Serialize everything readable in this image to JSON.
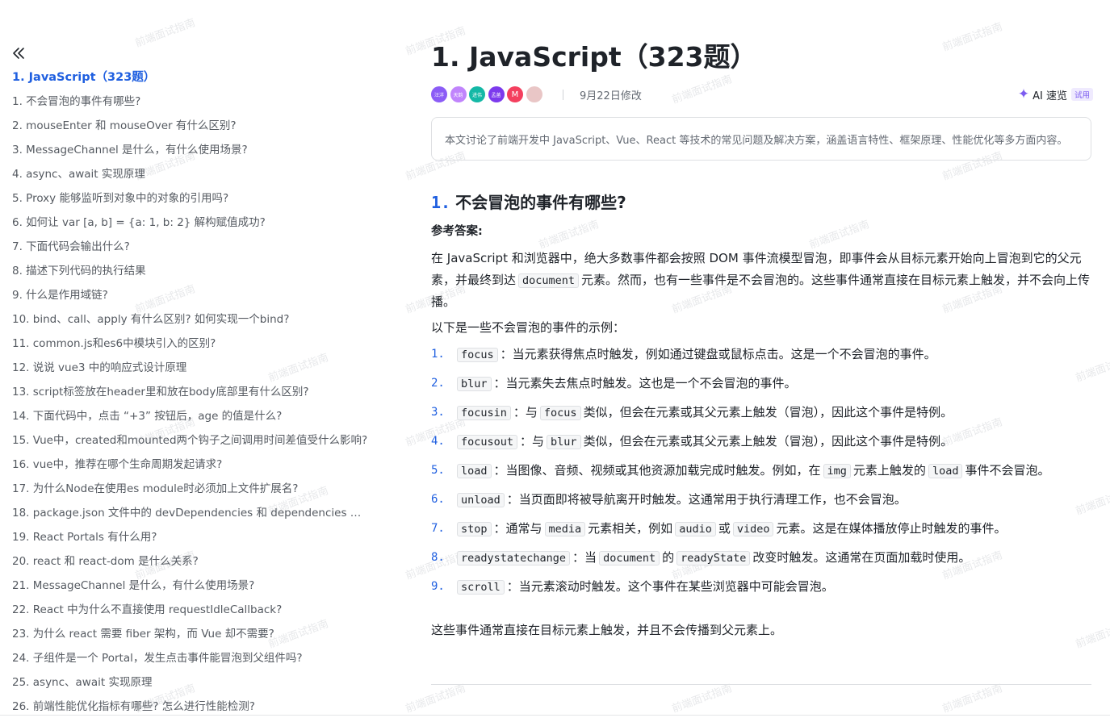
{
  "watermark": "前端面试指南",
  "sidebar": {
    "items": [
      "1. JavaScript（323题）",
      "1. 不会冒泡的事件有哪些?",
      "2. mouseEnter 和 mouseOver 有什么区别?",
      "3. MessageChannel 是什么，有什么使用场景?",
      "4. async、await 实现原理",
      "5. Proxy 能够监听到对象中的对象的引用吗?",
      "6. 如何让 var [a, b] = {a: 1, b: 2} 解构赋值成功?",
      "7. 下面代码会输出什么?",
      "8. 描述下列代码的执行结果",
      "9. 什么是作用域链?",
      "10. bind、call、apply 有什么区别? 如何实现一个bind?",
      "11. common.js和es6中模块引入的区别?",
      "12. 说说 vue3 中的响应式设计原理",
      "13. script标签放在header里和放在body底部里有什么区别?",
      "14. 下面代码中，点击 “+3” 按钮后，age 的值是什么?",
      "15. Vue中，created和mounted两个钩子之间调用时间差值受什么影响?",
      "16. vue中，推荐在哪个生命周期发起请求?",
      "17. 为什么Node在使用es module时必须加上文件扩展名?",
      "18. package.json 文件中的 devDependencies 和 dependencies 对象有...",
      "19. React Portals 有什么用?",
      "20. react 和 react-dom 是什么关系?",
      "21. MessageChannel 是什么，有什么使用场景?",
      "22. React 中为什么不直接使用 requestIdleCallback?",
      "23. 为什么 react 需要 fiber 架构，而 Vue 却不需要?",
      "24. 子组件是一个 Portal，发生点击事件能冒泡到父组件吗?",
      "25. async、await 实现原理",
      "26. 前端性能优化指标有哪些? 怎么进行性能检测?"
    ]
  },
  "doc": {
    "title": "1. JavaScript（323题）",
    "avatars": [
      {
        "label": "汪洋",
        "color": "#8b5cf6"
      },
      {
        "label": "天韵",
        "color": "#c084fc"
      },
      {
        "label": "进伟",
        "color": "#14b8a6"
      },
      {
        "label": "孟菡",
        "color": "#7c3aed"
      },
      {
        "label": "M",
        "color": "#f43f5e"
      },
      {
        "label": "",
        "color": "#e9c6c6"
      }
    ],
    "modified": "9月22日修改",
    "ai_label": "AI 速览",
    "ai_badge": "试用",
    "summary": "本文讨论了前端开发中 JavaScript、Vue、React 等技术的常见问题及解决方案，涵盖语言特性、框架原理、性能优化等多方面内容。"
  },
  "question": {
    "number": "1.",
    "title": "不会冒泡的事件有哪些?",
    "answer_label": "参考答案:",
    "para1": {
      "t1": "在 JavaScript 和浏览器中，绝大多数事件都会按照 DOM 事件流模型冒泡，即事件会从目标元素开始向上冒泡到它的父元素，并最终到达",
      "c1": "document",
      "t2": "元素。然而，也有一些事件是不会冒泡的。这些事件通常直接在目标元素上触发，并不会向上传播。"
    },
    "intro": "以下是一些不会冒泡的事件的示例：",
    "items": [
      {
        "n": "1.",
        "c1": "focus",
        "t1": "：当元素获得焦点时触发，例如通过键盘或鼠标点击。这是一个不会冒泡的事件。"
      },
      {
        "n": "2.",
        "c1": "blur",
        "t1": "：当元素失去焦点时触发。这也是一个不会冒泡的事件。"
      },
      {
        "n": "3.",
        "c1": "focusin",
        "t1": "：与",
        "c2": "focus",
        "t2": "类似，但会在元素或其父元素上触发（冒泡），因此这个事件是特例。"
      },
      {
        "n": "4.",
        "c1": "focusout",
        "t1": "：与",
        "c2": "blur",
        "t2": "类似，但会在元素或其父元素上触发（冒泡），因此这个事件是特例。"
      },
      {
        "n": "5.",
        "c1": "load",
        "t1": "：当图像、音频、视频或其他资源加载完成时触发。例如，在",
        "c2": "img",
        "t2": "元素上触发的",
        "c3": "load",
        "t3": "事件不会冒泡。"
      },
      {
        "n": "6.",
        "c1": "unload",
        "t1": "：当页面即将被导航离开时触发。这通常用于执行清理工作，也不会冒泡。"
      },
      {
        "n": "7.",
        "c1": "stop",
        "t1": "：通常与",
        "c2": "media",
        "t2": "元素相关，例如",
        "c3": "audio",
        "t3": "或",
        "c4": "video",
        "t4": "元素。这是在媒体播放停止时触发的事件。"
      },
      {
        "n": "8.",
        "c1": "readystatechange",
        "t1": "：当",
        "c2": "document",
        "t2": "的",
        "c3": "readyState",
        "t3": "改变时触发。这通常在页面加载时使用。"
      },
      {
        "n": "9.",
        "c1": "scroll",
        "t1": "：当元素滚动时触发。这个事件在某些浏览器中可能会冒泡。"
      }
    ],
    "closing": "这些事件通常直接在目标元素上触发，并且不会传播到父元素上。"
  }
}
